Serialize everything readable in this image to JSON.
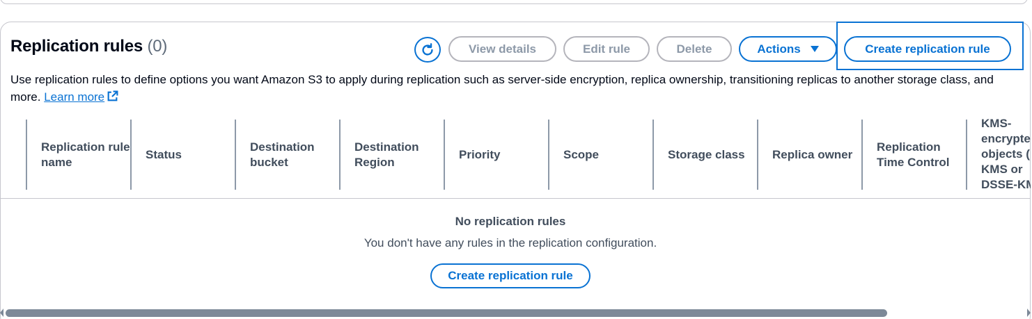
{
  "header": {
    "title": "Replication rules",
    "count": "(0)"
  },
  "toolbar": {
    "refresh_icon": "refresh-icon",
    "view_details_label": "View details",
    "edit_rule_label": "Edit rule",
    "delete_label": "Delete",
    "actions_label": "Actions",
    "create_rule_label": "Create replication rule"
  },
  "description": {
    "text": "Use replication rules to define options you want Amazon S3 to apply during replication such as server-side encryption, replica ownership, transitioning replicas to another storage class, and more.",
    "link_label": "Learn more",
    "link_icon": "external-link-icon"
  },
  "table": {
    "columns": [
      "Replication rule name",
      "Status",
      "Destination bucket",
      "Destination Region",
      "Priority",
      "Scope",
      "Storage class",
      "Replica owner",
      "Replication Time Control",
      "KMS-encrypted objects (SSE-KMS or DSSE-KMS)"
    ],
    "kms_header_lines": [
      "KMS-",
      "encrypted",
      "objects (",
      "KMS or",
      "DSSE-KM"
    ],
    "rows": []
  },
  "empty_state": {
    "title": "No replication rules",
    "subtitle": "You don't have any rules in the replication configuration.",
    "button_label": "Create replication rule"
  },
  "colors": {
    "accent": "#0972d3",
    "disabled": "#8d99a8",
    "text": "#000716",
    "muted": "#414d5c"
  }
}
